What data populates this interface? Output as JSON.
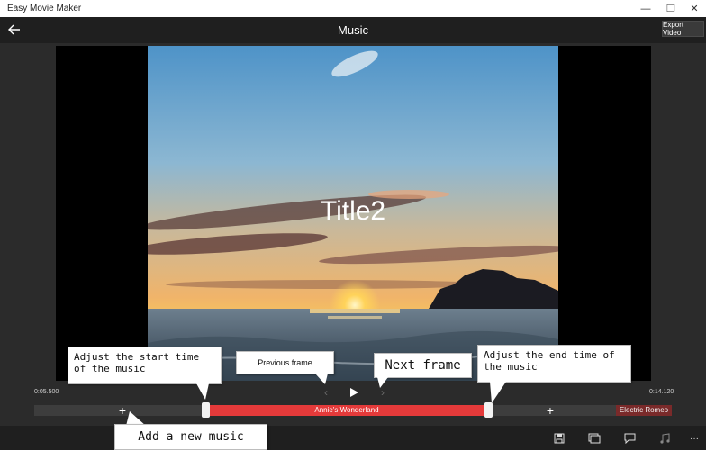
{
  "window": {
    "app_title": "Easy Movie Maker",
    "minimize_glyph": "—",
    "maximize_glyph": "❐",
    "close_glyph": "✕"
  },
  "header": {
    "back_icon": "back-arrow-icon",
    "title": "Music",
    "export_label": "Export Video"
  },
  "preview": {
    "overlay_title": "Title2",
    "scene": "sunset-over-sea"
  },
  "playback": {
    "start_time": "0:05.500",
    "end_time": "0:14.120",
    "prev_frame_glyph": "‹",
    "next_frame_glyph": "›",
    "play_icon": "play-icon"
  },
  "timeline": {
    "add_music_glyph": "+",
    "music_clips": [
      "Annie's Wonderland",
      "Electric Romeo"
    ],
    "active_clip_color": "#e43a3a"
  },
  "app_bar": {
    "icons": [
      "save-icon",
      "aspect-ratio-icon",
      "caption-icon",
      "music-icon",
      "more-icon"
    ],
    "more_glyph": "···"
  },
  "callouts": {
    "adjust_start": "Adjust the start time of the music",
    "previous_frame": "Previous frame",
    "next_frame": "Next frame",
    "adjust_end": "Adjust the end time of the music",
    "add_music": "Add a new music"
  }
}
